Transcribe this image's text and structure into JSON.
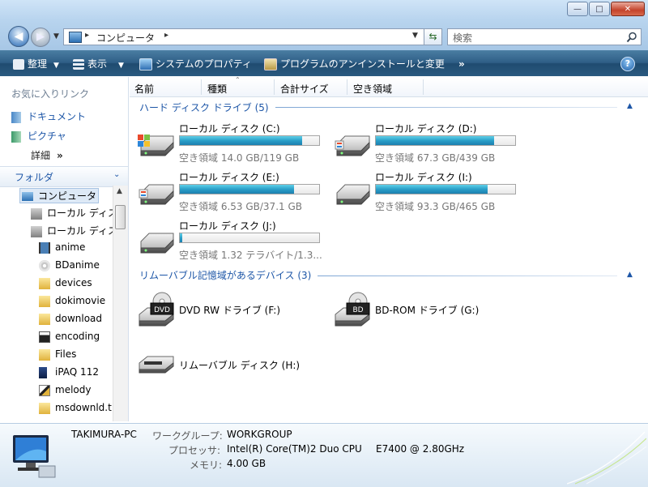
{
  "window": {
    "minimize": "—",
    "maximize": "□",
    "close": "✕"
  },
  "nav": {
    "back": "◀",
    "forward": "▶",
    "dropdown": "▼"
  },
  "address": {
    "crumbs": [
      "コンピュータ"
    ],
    "sep": "▸"
  },
  "search": {
    "placeholder": "検索"
  },
  "toolbar": {
    "organize": "整理",
    "view": "表示",
    "system_props": "システムのプロパティ",
    "uninstall": "プログラムのアンインストールと変更",
    "more": "»",
    "help": "?"
  },
  "favorites": {
    "header": "お気に入りリンク",
    "items": [
      "ドキュメント",
      "ピクチャ"
    ],
    "more": "詳細",
    "more_chev": "»"
  },
  "folders": {
    "header": "フォルダ",
    "items": [
      "コンピュータ",
      "ローカル ディス",
      "ローカル ディス",
      "anime",
      "BDanime",
      "devices",
      "dokimovie",
      "download",
      "encoding",
      "Files",
      "iPAQ 112",
      "melody",
      "msdownld.t"
    ]
  },
  "columns": {
    "name": "名前",
    "type": "種類",
    "total": "合計サイズ",
    "free": "空き領域"
  },
  "groups": {
    "hdd": "ハード ディスク ドライブ (5)",
    "removable": "リムーバブル記憶域があるデバイス (3)"
  },
  "drives": [
    {
      "name": "ローカル ディスク (C:)",
      "free": "空き領域 14.0 GB/119 GB",
      "used": 0.88
    },
    {
      "name": "ローカル ディスク (D:)",
      "free": "空き領域 67.3 GB/439 GB",
      "used": 0.85
    },
    {
      "name": "ローカル ディスク (E:)",
      "free": "空き領域 6.53 GB/37.1 GB",
      "used": 0.82
    },
    {
      "name": "ローカル ディスク (I:)",
      "free": "空き領域 93.3 GB/465 GB",
      "used": 0.8
    },
    {
      "name": "ローカル ディスク (J:)",
      "free": "空き領域 1.32 テラバイト/1.3...",
      "used": 0.02
    }
  ],
  "removables": [
    {
      "name": "DVD RW ドライブ (F:)",
      "badge": "DVD"
    },
    {
      "name": "BD-ROM ドライブ (G:)",
      "badge": "BD"
    },
    {
      "name": "リムーバブル ディスク (H:)"
    }
  ],
  "details": {
    "pc_name": "TAKIMURA-PC",
    "workgroup_label": "ワークグループ:",
    "workgroup": "WORKGROUP",
    "cpu_label": "プロセッサ:",
    "cpu": "Intel(R) Core(TM)2 Duo CPU",
    "cpu_model": "E7400  @ 2.80GHz",
    "mem_label": "メモリ:",
    "mem": "4.00 GB"
  }
}
